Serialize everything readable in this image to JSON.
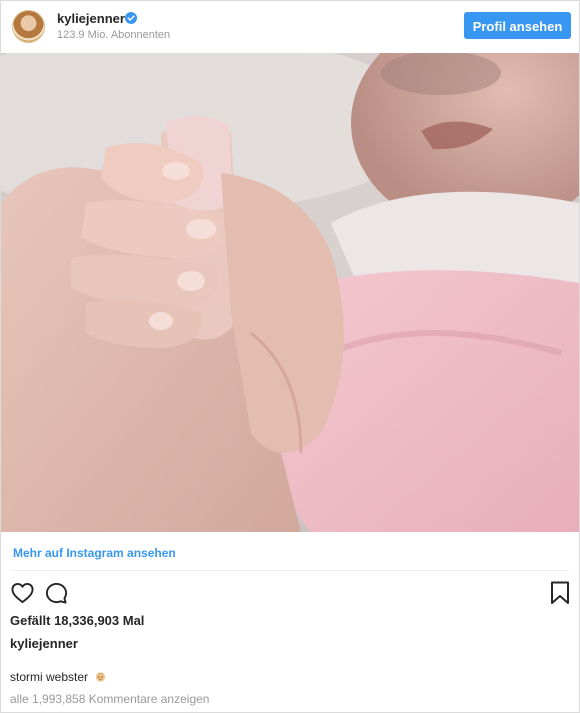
{
  "header": {
    "username": "kyliejenner",
    "followers": "123.9 Mio. Abonnenten",
    "profile_button": "Profil ansehen"
  },
  "post": {
    "more_link": "Mehr auf Instagram ansehen",
    "likes": "Gefällt 18,336,903 Mal",
    "author": "kyliejenner",
    "caption": "stormi webster",
    "comments": "alle 1,993,858 Kommentare anzeigen"
  },
  "icons": {
    "like": "heart-icon",
    "comment": "comment-icon",
    "save": "bookmark-icon",
    "verified": "verified-badge-icon"
  },
  "colors": {
    "accent": "#3897f0",
    "text": "#262626",
    "muted": "#999999",
    "border": "#dbdbdb"
  }
}
